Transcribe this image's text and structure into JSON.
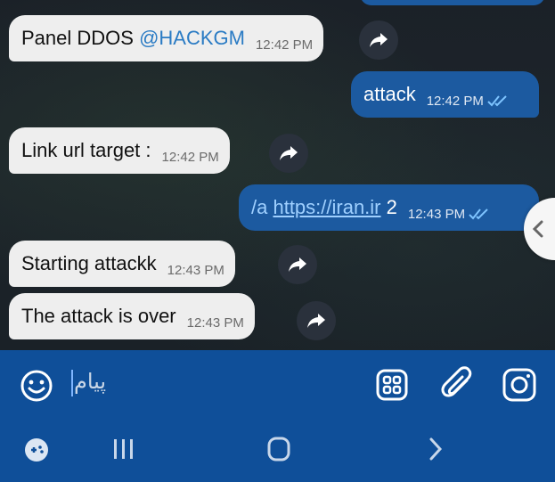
{
  "messages": [
    {
      "direction": "incoming",
      "text": "Panel DDOS ",
      "mention": "@HACKGM",
      "time": "12:42 PM"
    },
    {
      "direction": "outgoing",
      "text": "attack",
      "time": "12:42 PM",
      "status": "read"
    },
    {
      "direction": "incoming",
      "text": "Link url target :",
      "time": "12:42 PM"
    },
    {
      "direction": "outgoing",
      "prefix": "/a ",
      "link": "https://iran.ir",
      "suffix": " 2",
      "time": "12:43 PM",
      "status": "read"
    },
    {
      "direction": "incoming",
      "text": "Starting attackk",
      "time": "12:43 PM"
    },
    {
      "direction": "incoming",
      "text": "The attack is over",
      "time": "12:43 PM"
    }
  ],
  "composer": {
    "placeholder": "پیام"
  },
  "icons": {
    "emoji": "smiley-icon",
    "attach": "paperclip-icon",
    "camera": "instagram-camera-icon",
    "apps": "grid-icon",
    "share": "share-arrow-icon",
    "scroll": "chevron-left-icon",
    "game": "gamepad-icon",
    "nav_recents": "recents-icon",
    "nav_home": "home-icon",
    "nav_back": "back-icon"
  },
  "colors": {
    "incoming_bubble": "#eeeeee",
    "outgoing_bubble": "#1c5aa0",
    "bar": "#0f4f99",
    "mention": "#2a7bc4",
    "read_ticks": "#7ec4ff"
  }
}
